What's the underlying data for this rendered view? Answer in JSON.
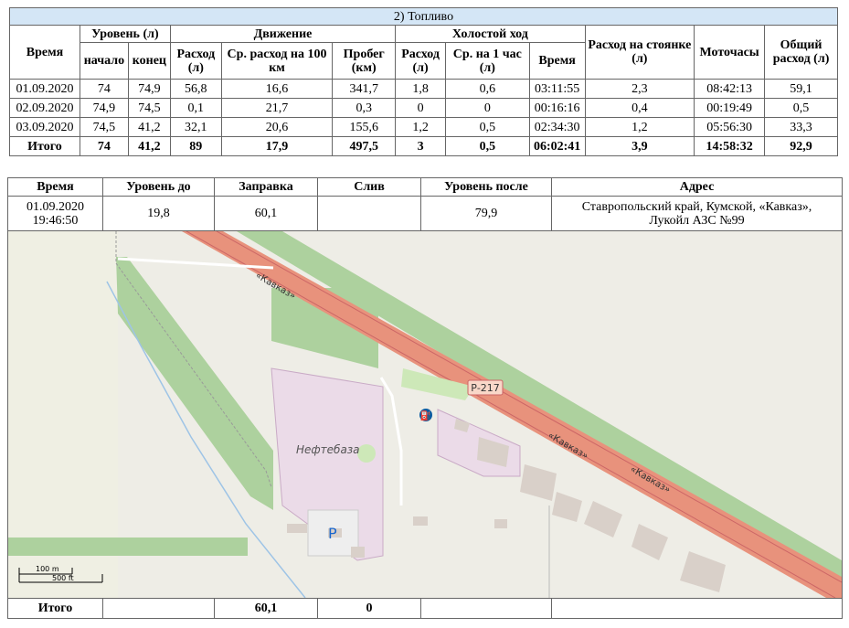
{
  "fuel": {
    "caption": "2) Топливо",
    "headers": {
      "time": "Время",
      "level": "Уровень (л)",
      "level_start": "начало",
      "level_end": "конец",
      "movement": "Движение",
      "consumption": "Расход (л)",
      "avg_per_100": "Ср. расход на 100 км",
      "mileage": "Пробег (км)",
      "idle": "Холостой ход",
      "idle_consumption": "Расход (л)",
      "idle_avg_hour": "Ср. на 1 час (л)",
      "idle_time": "Время",
      "parking": "Расход на стоянке (л)",
      "engine_hours": "Моточасы",
      "total": "Общий расход (л)"
    },
    "rows": [
      [
        "01.09.2020",
        "74",
        "74,9",
        "56,8",
        "16,6",
        "341,7",
        "1,8",
        "0,6",
        "03:11:55",
        "2,3",
        "08:42:13",
        "59,1"
      ],
      [
        "02.09.2020",
        "74,9",
        "74,5",
        "0,1",
        "21,7",
        "0,3",
        "0",
        "0",
        "00:16:16",
        "0,4",
        "00:19:49",
        "0,5"
      ],
      [
        "03.09.2020",
        "74,5",
        "41,2",
        "32,1",
        "20,6",
        "155,6",
        "1,2",
        "0,5",
        "02:34:30",
        "1,2",
        "05:56:30",
        "33,3"
      ]
    ],
    "total": [
      "Итого",
      "74",
      "41,2",
      "89",
      "17,9",
      "497,5",
      "3",
      "0,5",
      "06:02:41",
      "3,9",
      "14:58:32",
      "92,9"
    ]
  },
  "refuel": {
    "headers": {
      "time": "Время",
      "level_before": "Уровень до",
      "refuel": "Заправка",
      "drain": "Слив",
      "level_after": "Уровень после",
      "address": "Адрес"
    },
    "row": {
      "date": "01.09.2020",
      "time": "19:46:50",
      "level_before": "19,8",
      "refuel": "60,1",
      "drain": "",
      "level_after": "79,9",
      "address_line1": "Ставропольский край, Кумской, «Кавказ»,",
      "address_line2": "Лукойл АЗС №99"
    },
    "total": {
      "label": "Итого",
      "refuel": "60,1",
      "drain": "0"
    }
  },
  "map": {
    "road_label_1": "«Кавказ»",
    "road_label_2": "«Кавказ»",
    "road_label_3": "«Кавказ»",
    "road_shield": "Р-217",
    "depot_label": "Нефтебаза",
    "parking_label": "P",
    "scale_m": "100 m",
    "scale_ft": "500 ft",
    "colors": {
      "highway": "#e8927c",
      "green": "#add19e",
      "industrial": "#ebdbe8",
      "building": "#d9d0c9",
      "background": "#f2efe9"
    }
  }
}
